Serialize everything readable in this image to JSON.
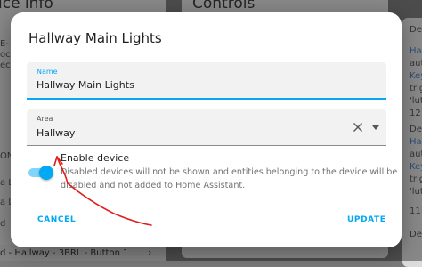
{
  "background": {
    "left_title": "ice info",
    "mid_title": "Controls",
    "left_lines": [
      "E-",
      "oc",
      "ect",
      "ON",
      "a LI",
      "a LI",
      "d"
    ],
    "right_lines": [
      {
        "text": "Dec",
        "blue": false
      },
      {
        "text": "Hall",
        "blue": true
      },
      {
        "text": "aut",
        "blue": false
      },
      {
        "text": "Key",
        "blue": true
      },
      {
        "text": "trig",
        "blue": false
      },
      {
        "text": "'lut",
        "blue": false
      },
      {
        "text": "12:",
        "blue": false
      },
      {
        "text": "Dec",
        "blue": false
      },
      {
        "text": "Hall",
        "blue": true
      },
      {
        "text": "aut",
        "blue": false
      },
      {
        "text": "Key",
        "blue": true
      },
      {
        "text": "trig",
        "blue": false
      },
      {
        "text": "'lut",
        "blue": false
      },
      {
        "text": "11:",
        "blue": false
      },
      {
        "text": "Dec",
        "blue": false
      }
    ],
    "footer_item": "d - Hallway - 3BRL - Button 1",
    "footer_chevron": "›"
  },
  "dialog": {
    "title": "Hallway Main Lights",
    "name_field": {
      "label": "Name",
      "value": "Hallway Main Lights"
    },
    "area_field": {
      "label": "Area",
      "value": "Hallway"
    },
    "enable_toggle": {
      "label": "Enable device",
      "checked": true,
      "description": "Disabled devices will not be shown and entities belonging to the device will be disabled and not added to Home Assistant."
    },
    "cancel_label": "CANCEL",
    "update_label": "UPDATE"
  },
  "colors": {
    "accent": "#03a9f4",
    "annotation": "#e11d1d"
  },
  "icons": {
    "clear": "close-icon",
    "dropdown": "dropdown-arrow-icon"
  }
}
